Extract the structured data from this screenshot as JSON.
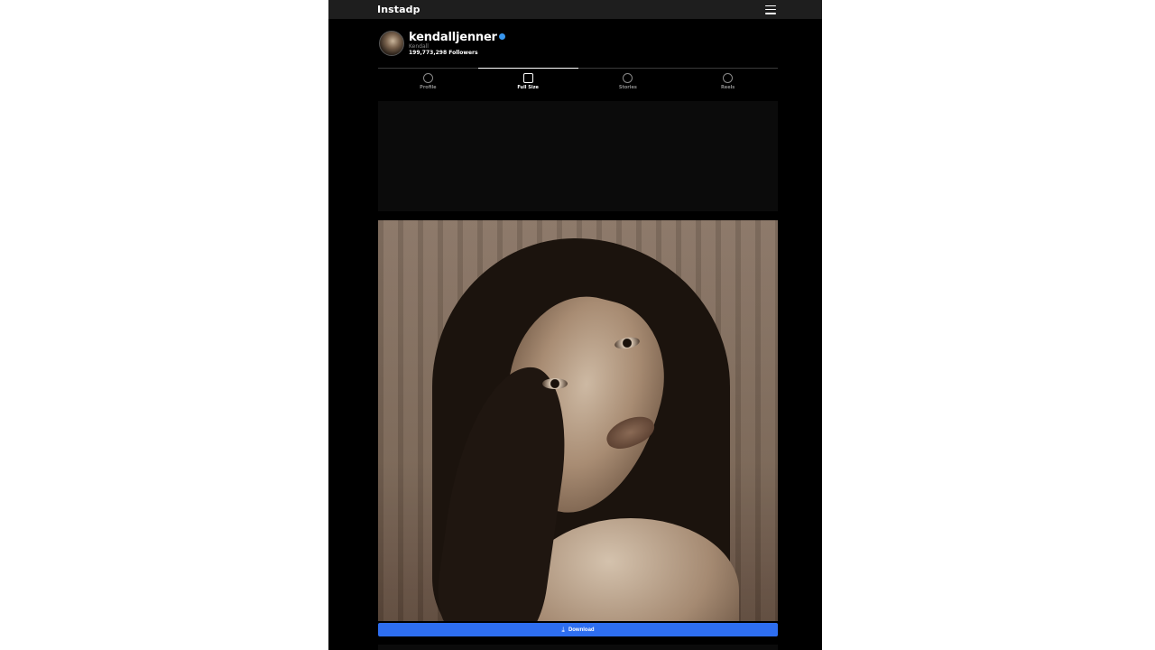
{
  "header": {
    "brand": "Instadp",
    "menu_icon": "hamburger-menu-icon"
  },
  "profile": {
    "username": "kendalljenner",
    "verified": true,
    "full_name": "Kendall",
    "followers": "199,773,298 Followers"
  },
  "tabs": [
    {
      "label": "Profile",
      "icon": "profile-circle-icon",
      "active": false
    },
    {
      "label": "Full Size",
      "icon": "scan-focus-icon",
      "active": true
    },
    {
      "label": "Stories",
      "icon": "play-circle-icon",
      "active": false
    },
    {
      "label": "Reels",
      "icon": "reels-icon",
      "active": false
    }
  ],
  "actions": {
    "download_label": "Download",
    "download_icon": "download-icon"
  },
  "colors": {
    "page_bg": "#000000",
    "topbar": "#1e1e1e",
    "accent_button": "#2e6ef0",
    "verified": "#3897f0"
  }
}
